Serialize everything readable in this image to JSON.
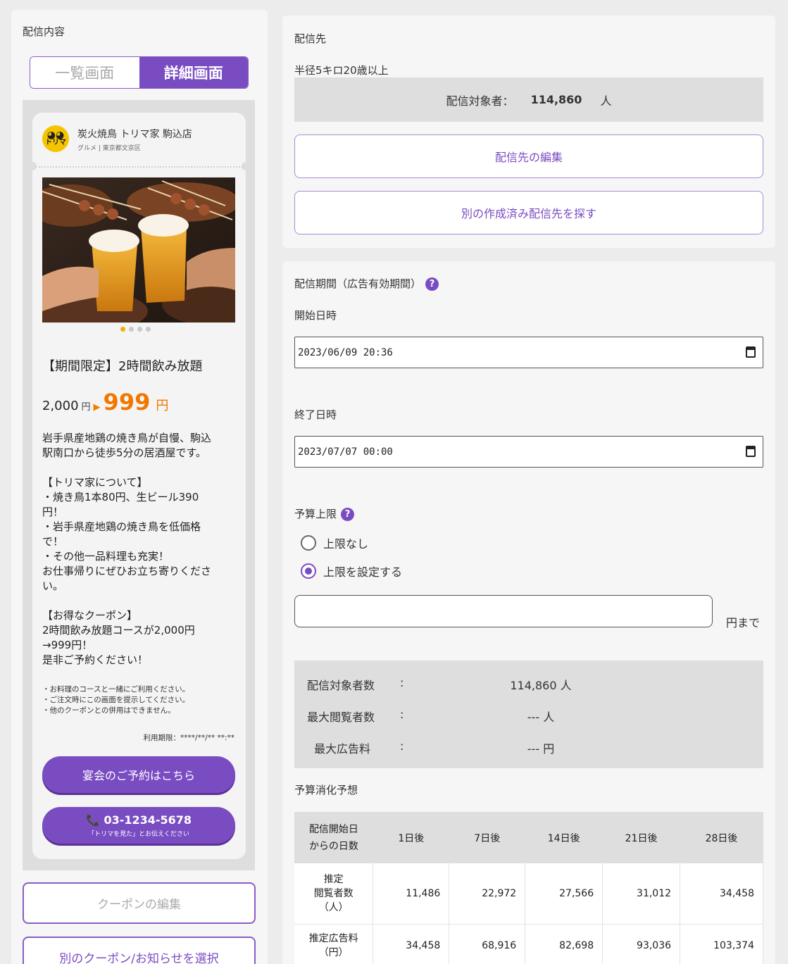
{
  "left": {
    "title": "配信内容",
    "toggle": {
      "list": "一覧画面",
      "detail": "詳細画面"
    },
    "coupon": {
      "logo_text": "トリマ",
      "shop_name": "炭火焼鳥 トリマ家 駒込店",
      "shop_sub": "グルメ | 東京都文京区",
      "title": "【期間限定】2時間飲み放題",
      "price_old": "2,000",
      "price_old_unit": "円",
      "price_new": "999",
      "price_new_unit": "円",
      "description": "岩手県産地鶏の焼き鳥が自慢、駒込\n駅南口から徒歩5分の居酒屋です。\n\n【トリマ家について】\n・焼き鳥1本80円、生ビール390\n円！\n・岩手県産地鶏の焼き鳥を低価格\nで！\n・その他一品料理も充実！\nお仕事帰りにぜひお立ち寄りくださ\nい。\n\n【お得なクーポン】\n2時間飲み放題コースが2,000円\n→999円！\n是非ご予約ください！",
      "notes": "・お料理のコースと一緒にご利用ください。\n・ご注文時にこの画面を提示してください。\n・他のクーポンとの併用はできません。",
      "expiry": "利用期限：****/**/** **:**",
      "reserve_button": "宴会のご予約はこちら",
      "phone_number": "03-1234-5678",
      "phone_sub": "「トリマを見た」とお伝えください"
    },
    "edit_coupon_button": "クーポンの編集",
    "select_other_button": "別のクーポン/お知らせを選択"
  },
  "destination": {
    "title": "配信先",
    "name": "半径5キロ20歳以上",
    "target_label": "配信対象者：",
    "target_count": "114,860",
    "target_unit": "人",
    "edit_button": "配信先の編集",
    "find_button": "別の作成済み配信先を探す"
  },
  "period": {
    "title": "配信期間（広告有効期間）",
    "start_label": "開始日時",
    "start_value": "2023/06/09 20:36",
    "end_label": "終了日時",
    "end_value": "2023/07/07 00:00",
    "budget_label": "予算上限",
    "budget_options": [
      "上限なし",
      "上限を設定する"
    ],
    "budget_selected": 1,
    "budget_value": "",
    "budget_unit": "円まで",
    "stats": [
      {
        "label": "配信対象者数",
        "value": "114,860 人"
      },
      {
        "label": "最大閲覧者数",
        "value": "--- 人"
      },
      {
        "label": "最大広告料",
        "value": "--- 円"
      }
    ],
    "forecast_title": "予算消化予想",
    "forecast": {
      "header_first": "配信開始日\nからの日数",
      "columns": [
        "1日後",
        "7日後",
        "14日後",
        "21日後",
        "28日後"
      ],
      "rows": [
        {
          "label": "推定\n閲覧者数\n（人）",
          "values": [
            "11,486",
            "22,972",
            "27,566",
            "31,012",
            "34,458"
          ]
        },
        {
          "label": "推定広告料\n（円）",
          "values": [
            "34,458",
            "68,916",
            "82,698",
            "93,036",
            "103,374"
          ]
        }
      ]
    }
  },
  "colors": {
    "accent": "#7a4cc2",
    "price": "#f07800"
  }
}
